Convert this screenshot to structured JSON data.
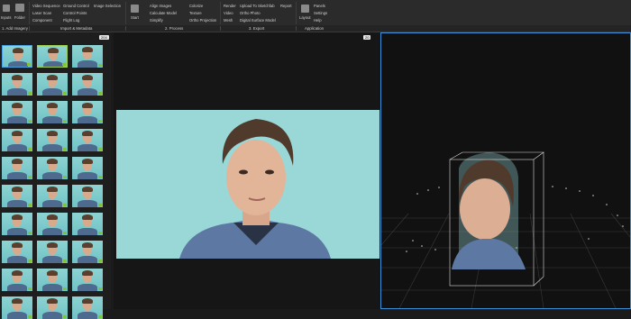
{
  "toolbar": {
    "groups": [
      {
        "label": "1. Add Imagery",
        "items": [
          {
            "label": "Inputs",
            "icon": "inputs-icon"
          },
          {
            "label": "Folder",
            "icon": "folder-icon"
          }
        ]
      },
      {
        "label": "Import & Metadata",
        "items": [
          {
            "label": "Video Sequence"
          },
          {
            "label": "Laser Scan"
          },
          {
            "label": "Component"
          },
          {
            "label": "Ground Control"
          },
          {
            "label": "Control Points"
          },
          {
            "label": "Flight Log"
          },
          {
            "label": "Image Selection"
          }
        ]
      },
      {
        "label": "2. Process",
        "items": [
          {
            "label": "Start",
            "icon": "start-icon"
          },
          {
            "label": "Align Images"
          },
          {
            "label": "Calculate Model"
          },
          {
            "label": "Simplify"
          },
          {
            "label": "Colorize"
          },
          {
            "label": "Texture"
          },
          {
            "label": "Ortho Projection"
          }
        ]
      },
      {
        "label": "3. Export",
        "items": [
          {
            "label": "Render"
          },
          {
            "label": "Video"
          },
          {
            "label": "Mesh"
          },
          {
            "label": "Upload To Sketchfab"
          },
          {
            "label": "Ortho Photo"
          },
          {
            "label": "Digital Surface Model"
          },
          {
            "label": "Report"
          }
        ]
      },
      {
        "label": "Application",
        "items": [
          {
            "label": "Layout",
            "icon": "layout-icon"
          },
          {
            "label": "Panels"
          },
          {
            "label": "Settings"
          },
          {
            "label": "Help"
          }
        ]
      }
    ]
  },
  "panels": {
    "left_count": "204",
    "mid_count": "20"
  },
  "colors": {
    "accent": "#3d8fd8",
    "check": "#7ec23d",
    "background": "#1b1b1b"
  },
  "thumbnails": {
    "rows": 10,
    "cols": 3,
    "selected_index": 0,
    "secondary_selected_index": 1
  }
}
